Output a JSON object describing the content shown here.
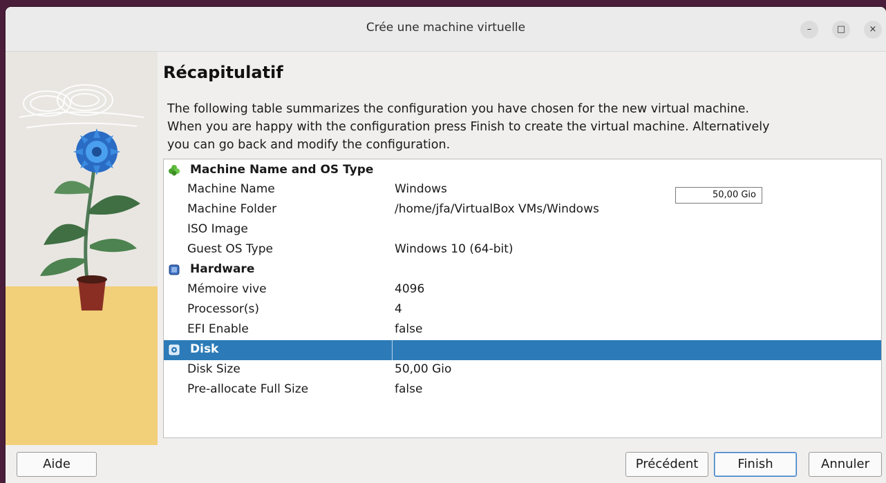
{
  "window": {
    "title": "Crée une machine virtuelle",
    "controls": {
      "minimize": "–",
      "maximize": "□",
      "close": "×"
    }
  },
  "page": {
    "heading": "Récapitulatif",
    "description": "The following table summarizes the configuration you have chosen for the new virtual machine. When you are happy with the configuration press Finish to create the virtual machine. Alternatively you can go back and modify the configuration."
  },
  "summary": {
    "sections": [
      {
        "title": "Machine Name and OS Type",
        "icon": "os-type-icon",
        "rows": [
          {
            "key": "Machine Name",
            "value": "Windows"
          },
          {
            "key": "Machine Folder",
            "value": "/home/jfa/VirtualBox VMs/Windows"
          },
          {
            "key": "ISO Image",
            "value": ""
          },
          {
            "key": "Guest OS Type",
            "value": "Windows 10 (64-bit)"
          }
        ]
      },
      {
        "title": "Hardware",
        "icon": "chip-icon",
        "rows": [
          {
            "key": "Mémoire vive",
            "value": "4096"
          },
          {
            "key": "Processor(s)",
            "value": "4"
          },
          {
            "key": "EFI Enable",
            "value": "false"
          }
        ]
      },
      {
        "title": "Disk",
        "icon": "disk-icon",
        "selected": true,
        "rows": [
          {
            "key": "Disk Size",
            "value": "50,00 Gio"
          },
          {
            "key": "Pre-allocate Full Size",
            "value": "false"
          }
        ]
      }
    ],
    "floating_size_field": "50,00 Gio"
  },
  "buttons": {
    "help": {
      "mnemonic": "A",
      "rest": "ide"
    },
    "back": {
      "mnemonic": "P",
      "rest": "récédent"
    },
    "finish": {
      "mnemonic": "F",
      "rest": "inish"
    },
    "cancel": {
      "mnemonic": "A",
      "rest": "nnuler"
    }
  },
  "colors": {
    "selection": "#2c7bb8",
    "window_bg": "#f0efee",
    "desktop_bg": "#4a1e3a"
  }
}
